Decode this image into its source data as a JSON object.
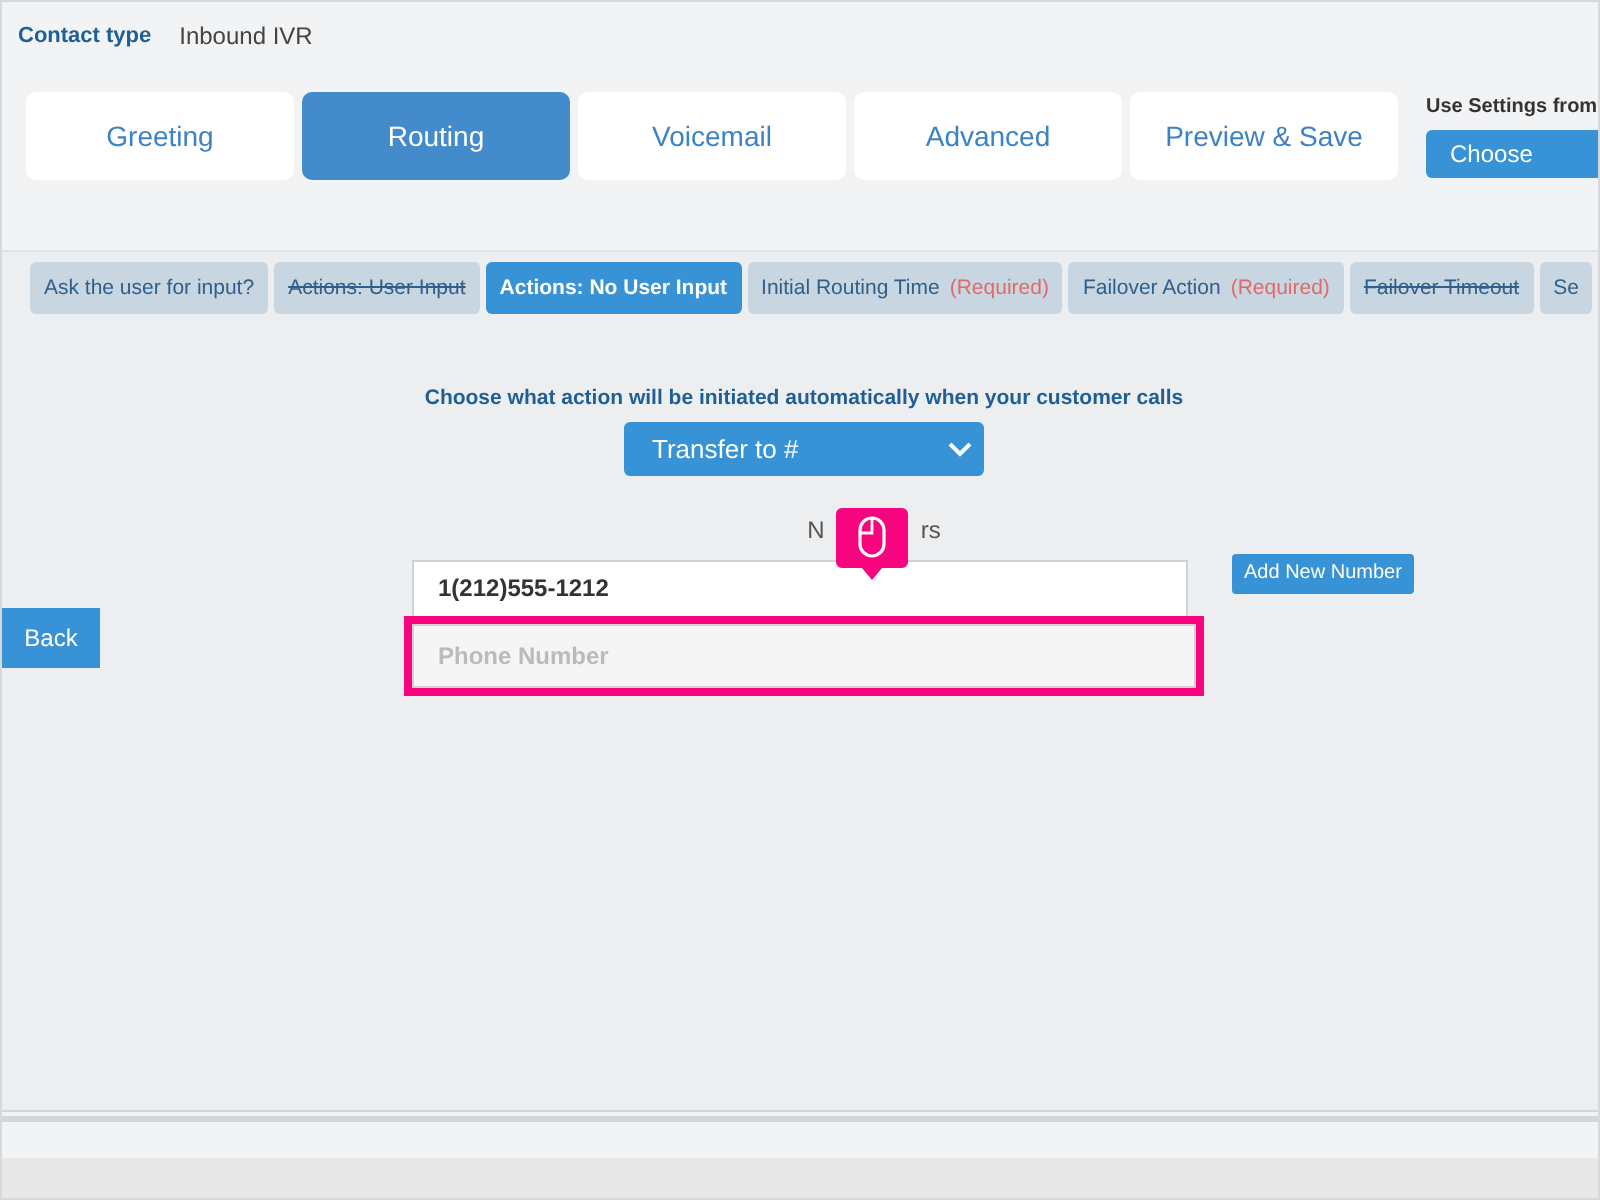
{
  "contact_type": {
    "label": "Contact type",
    "value": "Inbound IVR"
  },
  "tabs": [
    {
      "label": "Greeting",
      "selected": false
    },
    {
      "label": "Routing",
      "selected": true
    },
    {
      "label": "Voicemail",
      "selected": false
    },
    {
      "label": "Advanced",
      "selected": false
    },
    {
      "label": "Preview & Save",
      "selected": false
    }
  ],
  "use_settings": {
    "label": "Use Settings from",
    "value": "Choose"
  },
  "steps": [
    {
      "label": "Ask the user for input?",
      "selected": false,
      "struck": false
    },
    {
      "label": "Actions: User Input",
      "selected": false,
      "struck": true
    },
    {
      "label": "Actions: No User Input",
      "selected": true,
      "struck": false
    },
    {
      "label": "Initial Routing Time",
      "required": "(Required)",
      "selected": false,
      "struck": false
    },
    {
      "label": "Failover Action",
      "required": "(Required)",
      "selected": false,
      "struck": false
    },
    {
      "label": "Failover Timeout",
      "selected": false,
      "struck": true
    },
    {
      "label": "Se",
      "selected": false,
      "struck": false
    }
  ],
  "question": "Choose what action will be initiated automatically when your customer calls",
  "action_select": {
    "value": "Transfer to #"
  },
  "numbers_label_parts": [
    "N",
    "rs"
  ],
  "numbers": [
    {
      "value": "1(212)555-1212",
      "highlighted": false
    },
    {
      "placeholder": "Phone Number",
      "highlighted": true
    }
  ],
  "add_button": "Add New Number",
  "back_button": "Back"
}
